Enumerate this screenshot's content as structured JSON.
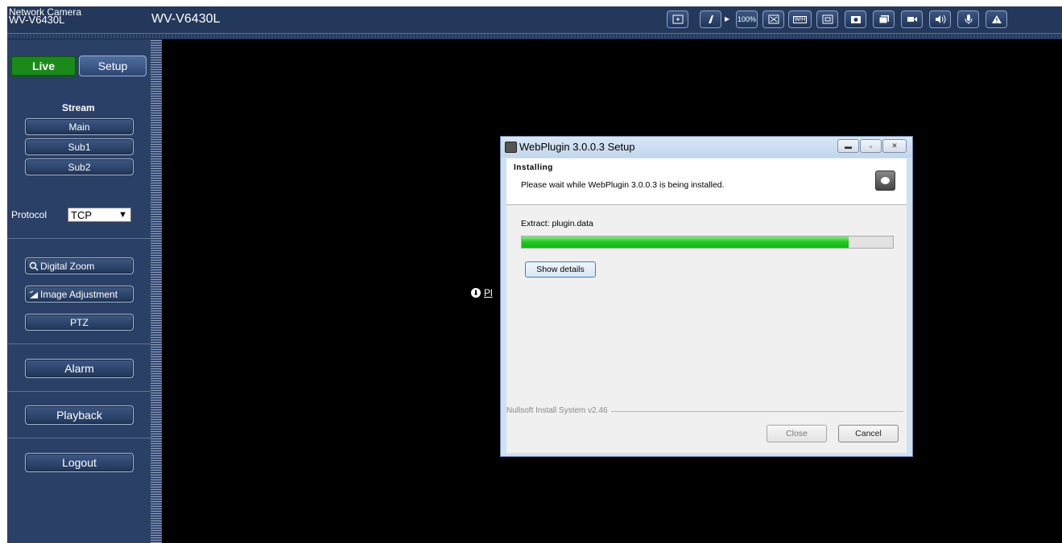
{
  "header": {
    "brand_line1": "Network Camera",
    "brand_line2": "WV-V6430L",
    "model": "WV-V6430L",
    "toolbar": {
      "zoom_100": "100%",
      "wh_label": "W/H",
      "icons": [
        "focus-assist-icon",
        "brightness-icon",
        "zoom-100-icon",
        "fit-screen-icon",
        "wh-aspect-icon",
        "multi-screen-icon",
        "snapshot-icon",
        "window-icon",
        "record-icon",
        "speaker-icon",
        "microphone-icon",
        "alert-icon"
      ]
    }
  },
  "sidebar": {
    "live_tab": "Live",
    "setup_tab": "Setup",
    "stream_label": "Stream",
    "stream_buttons": [
      "Main",
      "Sub1",
      "Sub2"
    ],
    "protocol_label": "Protocol",
    "protocol_value": "TCP",
    "digital_zoom": "Digital Zoom",
    "image_adjustment": "Image Adjustment",
    "ptz": "PTZ",
    "alarm": "Alarm",
    "playback": "Playback",
    "logout": "Logout"
  },
  "viewer": {
    "plugin_link": "Pl"
  },
  "dialog": {
    "title": "WebPlugin 3.0.0.3 Setup",
    "heading": "Installing",
    "subheading": "Please wait while WebPlugin 3.0.0.3 is being installed.",
    "extract_text": "Extract: plugin.data",
    "progress_fraction": 0.88,
    "show_details": "Show details",
    "nsis_label": "Nullsoft Install System v2.46",
    "close_button": "Close",
    "cancel_button": "Cancel"
  },
  "colors": {
    "header_bg": "#24385b",
    "live_green": "#1a8a1a",
    "progress_green": "#1ec81e"
  }
}
